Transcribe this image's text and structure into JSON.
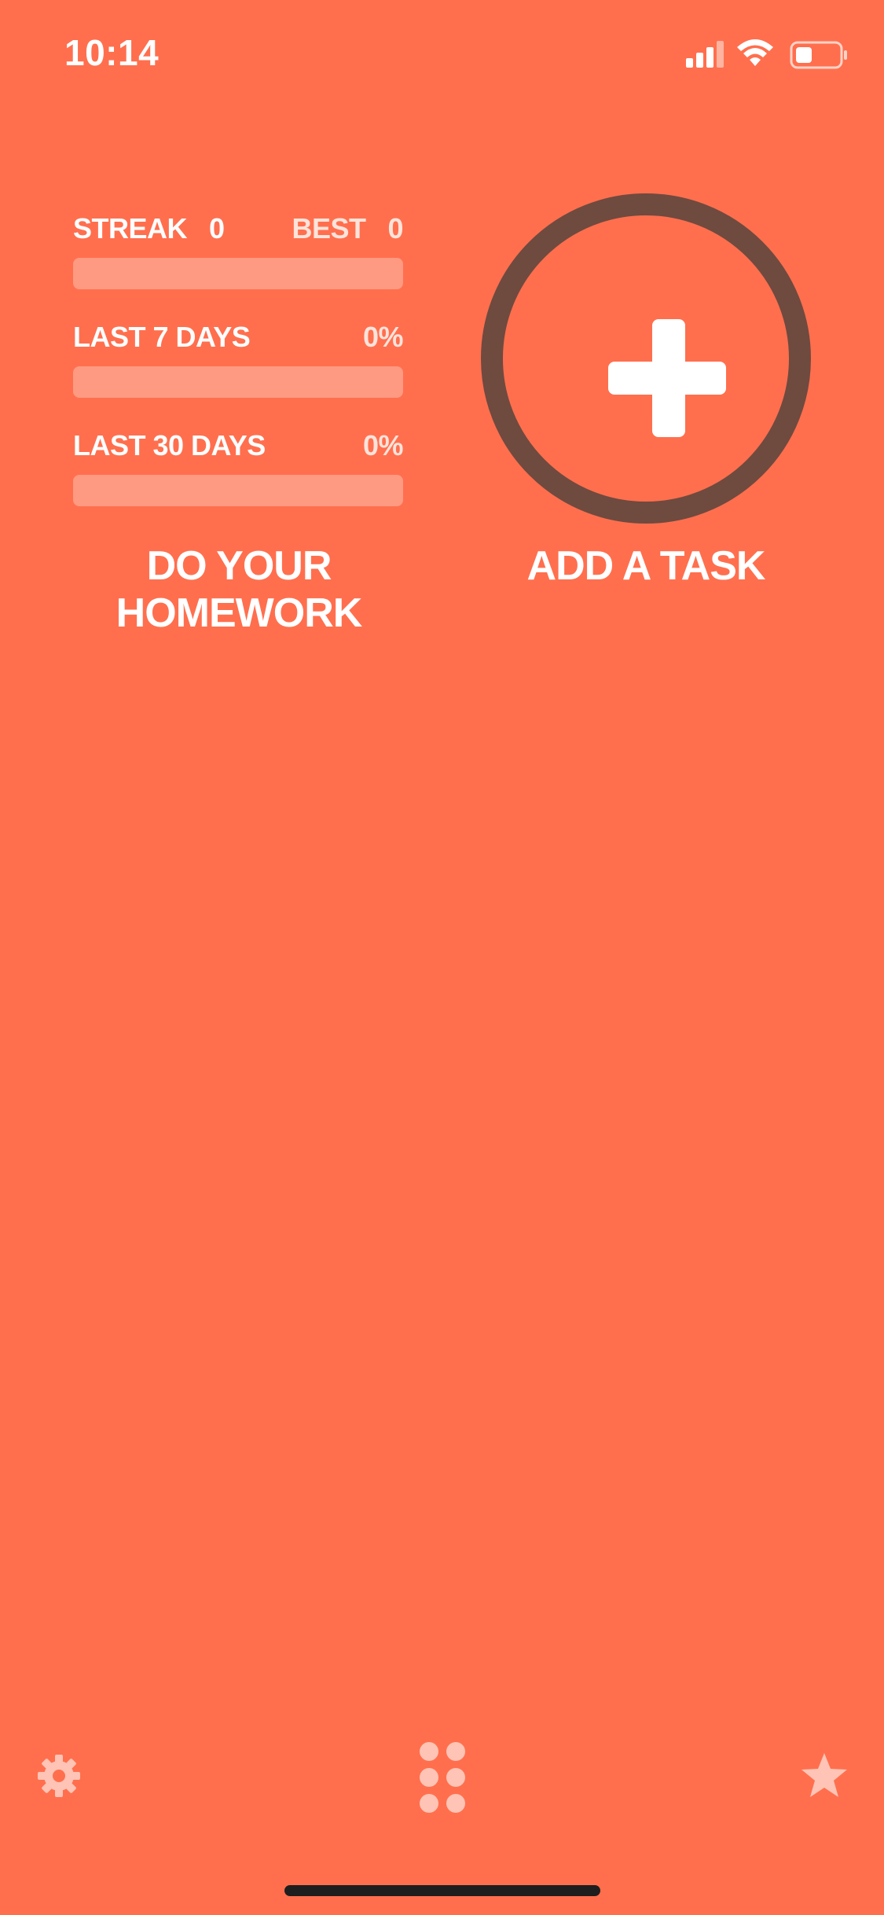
{
  "status_bar": {
    "time": "10:14",
    "icons": [
      "signal-icon",
      "wifi-icon",
      "battery-icon"
    ]
  },
  "stats": {
    "streak_label": "STREAK",
    "streak_value": "0",
    "best_label": "BEST",
    "best_value": "0",
    "streak_progress": 0,
    "last7_label": "LAST 7 DAYS",
    "last7_value": "0%",
    "last7_progress": 0,
    "last30_label": "LAST 30 DAYS",
    "last30_value": "0%",
    "last30_progress": 0
  },
  "task": {
    "title": "DO YOUR HOMEWORK"
  },
  "add_task": {
    "label": "ADD A TASK",
    "icon": "plus-icon"
  },
  "bottom_bar": {
    "left_icon": "gear-icon",
    "center_icon": "grid-icon",
    "right_icon": "star-icon"
  },
  "colors": {
    "background": "#FF6F4E",
    "track": "#FF9A82",
    "ring": "#6F4A3F",
    "text": "#FFFFFF",
    "faded_text": "#FFE3DA",
    "home_indicator": "#1E1E1E"
  }
}
